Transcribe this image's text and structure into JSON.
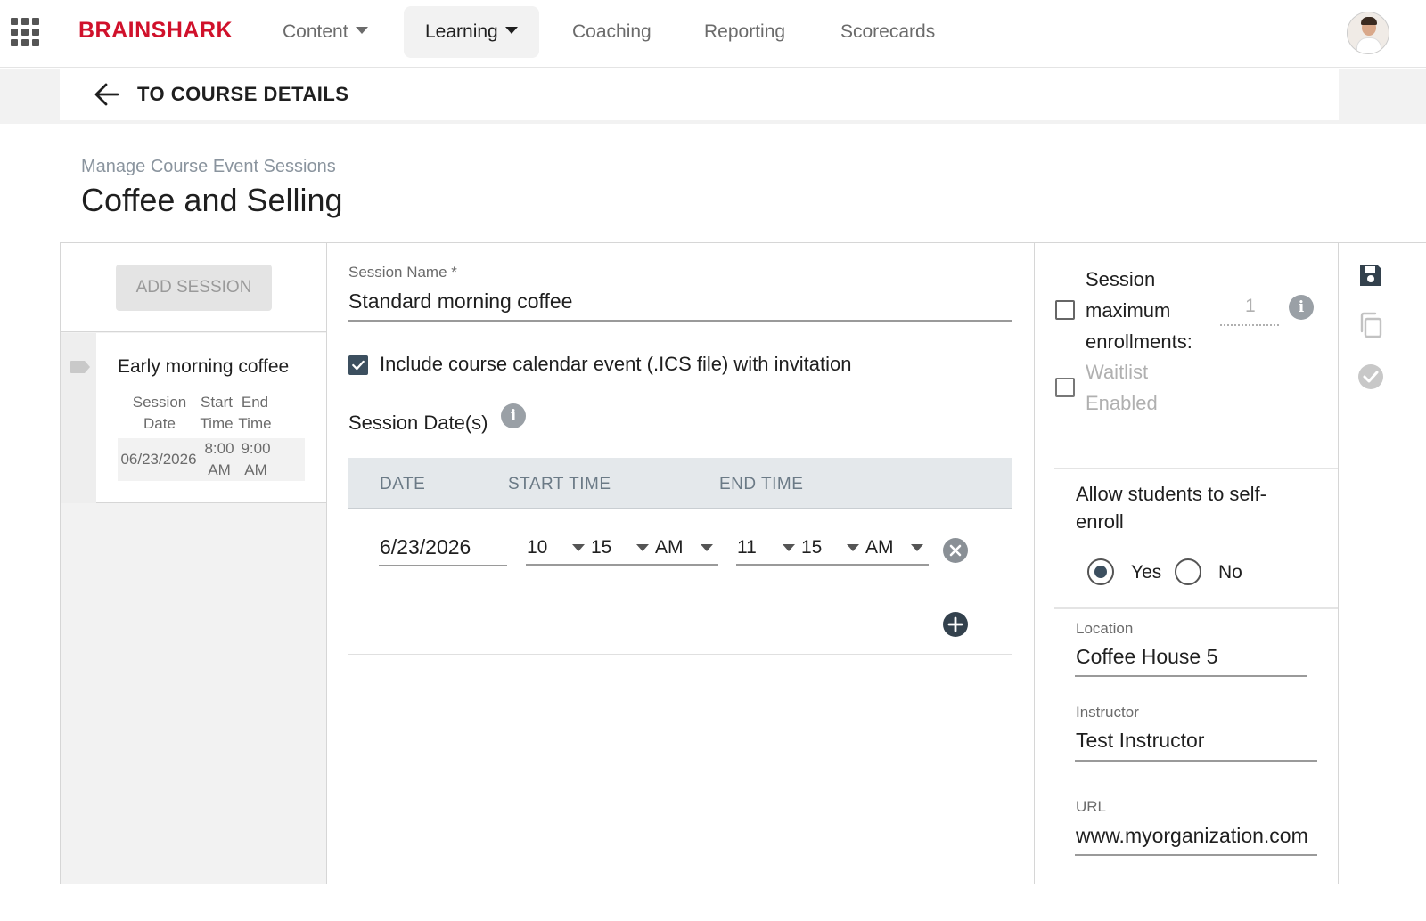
{
  "brand": {
    "logo_text": "BRAINSHARK"
  },
  "nav": {
    "items": [
      {
        "label": "Content",
        "has_caret": true,
        "active": false
      },
      {
        "label": "Learning",
        "has_caret": true,
        "active": true
      },
      {
        "label": "Coaching",
        "has_caret": false,
        "active": false
      },
      {
        "label": "Reporting",
        "has_caret": false,
        "active": false
      },
      {
        "label": "Scorecards",
        "has_caret": false,
        "active": false
      }
    ]
  },
  "back": {
    "label": "TO COURSE DETAILS"
  },
  "header": {
    "breadcrumb": "Manage Course Event Sessions",
    "title": "Coffee and Selling"
  },
  "sessions": {
    "add_label": "ADD SESSION",
    "items": [
      {
        "title": "Early morning coffee",
        "head_date": [
          "Session",
          "Date"
        ],
        "head_start": [
          "Start",
          "Time"
        ],
        "head_end": [
          "End",
          "Time"
        ],
        "date": "06/23/2026",
        "start": [
          "8:00",
          "AM"
        ],
        "end": [
          "9:00",
          "AM"
        ]
      }
    ]
  },
  "form": {
    "session_name_label": "Session Name *",
    "session_name_value": "Standard morning coffee",
    "ics_label": "Include course calendar event (.ICS file) with invitation",
    "ics_checked": true,
    "dates_label": "Session Date(s)",
    "table_headers": {
      "date": "DATE",
      "start": "START TIME",
      "end": "END TIME"
    },
    "rows": [
      {
        "date": "6/23/2026",
        "start_hour": "10",
        "start_min": "15",
        "start_ampm": "AM",
        "end_hour": "11",
        "end_min": "15",
        "end_ampm": "AM"
      }
    ]
  },
  "settings": {
    "max_enroll_lines": [
      "Session",
      "maximum",
      "enrollments:"
    ],
    "max_enroll_value": "1",
    "waitlist_lines": [
      "Waitlist",
      "Enabled"
    ],
    "self_enroll_lines": [
      "Allow students to self-",
      "enroll"
    ],
    "self_enroll_yes": "Yes",
    "self_enroll_no": "No",
    "self_enroll_selected": "Yes",
    "location_label": "Location",
    "location_value": "Coffee House 5",
    "instructor_label": "Instructor",
    "instructor_value": "Test Instructor",
    "url_label": "URL",
    "url_value": "www.myorganization.com"
  },
  "colors": {
    "brand": "#d0112b",
    "accent": "#3c4f5f"
  },
  "icons": {
    "app_grid": "grid-icon",
    "back": "arrow-left-icon",
    "save": "save-icon",
    "copy": "copy-icon",
    "done": "check-circle-icon"
  }
}
